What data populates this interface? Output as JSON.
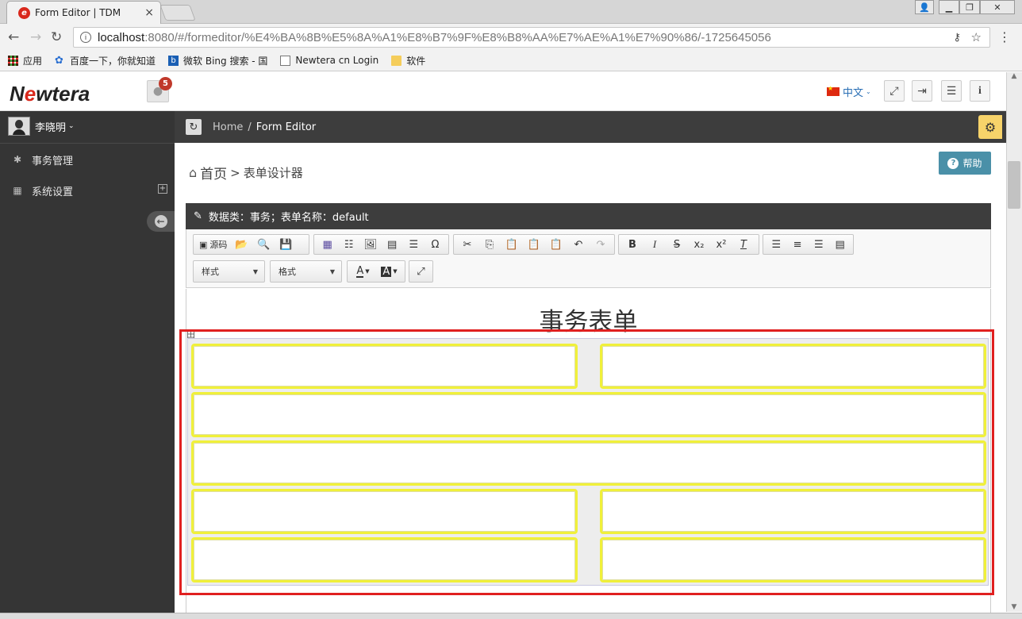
{
  "browser": {
    "tab_title": "Form Editor | TDM",
    "tab_close": "×",
    "url_host": "localhost",
    "url_rest": ":8080/#/formeditor/%E4%BA%8B%E5%8A%A1%E8%B7%9F%E8%B8%AA%E7%AE%A1%E7%90%86/-1725645056",
    "bookmarks": [
      "应用",
      "百度一下，你就知道",
      "微软 Bing 搜索 - 国",
      "Newtera cn Login",
      "软件"
    ]
  },
  "header": {
    "logo_pre": "N",
    "logo_o": "e",
    "logo_post": "wtera",
    "notification_count": "5",
    "language": "中文"
  },
  "sidebar": {
    "user_name": "李晓明",
    "items": [
      {
        "label": "事务管理",
        "icon": "bug-icon"
      },
      {
        "label": "系统设置",
        "icon": "building-icon"
      }
    ],
    "expand_symbol": "+"
  },
  "breadcrumb": {
    "home": "Home",
    "separator": "/",
    "current": "Form Editor"
  },
  "page": {
    "title_home": "首页",
    "title_sep": ">",
    "title_sub": "表单设计器",
    "help_label": "帮助"
  },
  "panel": {
    "heading": "数据类：事务；表单名称：default"
  },
  "toolbar": {
    "source_label": "源码",
    "style_combo": "样式",
    "format_combo": "格式"
  },
  "editor": {
    "form_title": "事务表单",
    "table_handle": "田"
  },
  "colors": {
    "sidebar_bg": "#353535",
    "cell_border": "#f0f03a",
    "highlight": "#e02020",
    "help_button": "#4a90a8",
    "settings_button": "#f7d36a"
  }
}
